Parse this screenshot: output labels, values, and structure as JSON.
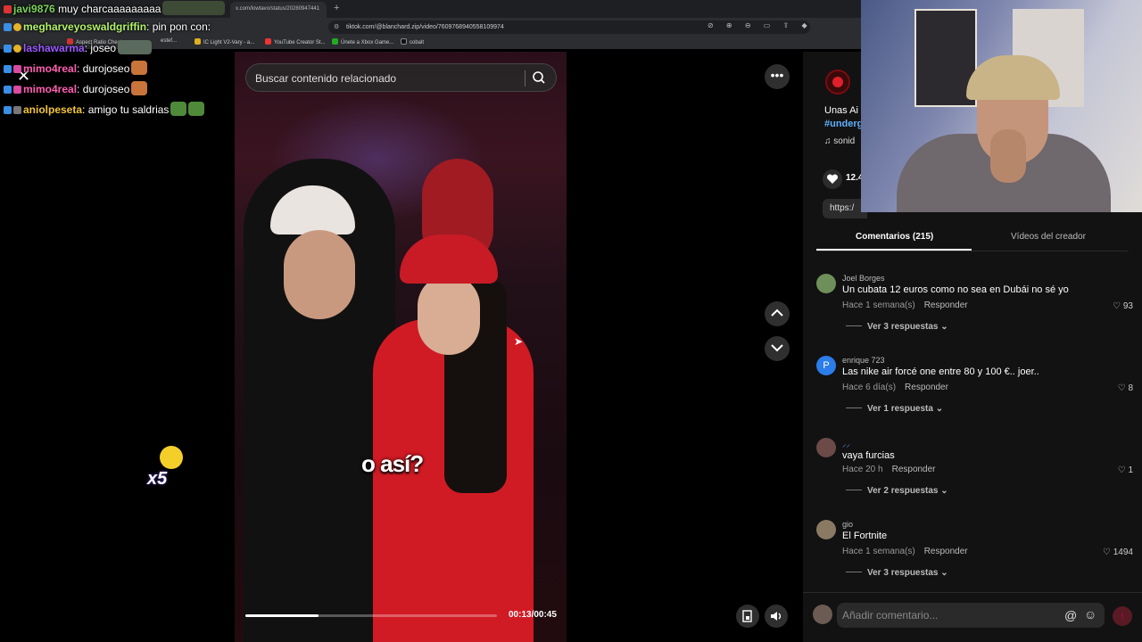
{
  "browser": {
    "tab_title": "x.com/lowtavo/status/20280947441",
    "url": "tiktok.com/@blanchard.zip/video/7609768940558109974",
    "bookmarks": [
      "Aspect Ratio Cheat",
      "estef...",
      "IC Light V2-Vary - a...",
      "YouTube Creator St...",
      "Únete a Xbox Game...",
      "cobalt"
    ]
  },
  "chat": [
    {
      "user": "javi9876",
      "text": "muy charcaaaaaaaaa",
      "color": "#7cd25a"
    },
    {
      "user": "megharveyoswaldgriffin",
      "text": "pin pon con:",
      "color": "#b2f26a"
    },
    {
      "user": "lashawarma",
      "text": "joseo",
      "color": "#9b59ff"
    },
    {
      "user": "mimo4real",
      "text": "durojoseo",
      "color": "#ff5fb2"
    },
    {
      "user": "mimo4real",
      "text": "durojoseo",
      "color": "#ff5fb2"
    },
    {
      "user": "aniolpeseta",
      "text": "amigo tu saldrias",
      "color": "#f2c53a"
    }
  ],
  "bits": {
    "multiplier": "x5"
  },
  "video": {
    "search_placeholder": "Buscar contenido relacionado",
    "caption": "o así?",
    "time": "00:13/00:45",
    "progress": 0.29
  },
  "post": {
    "title": "Unas Ai",
    "hashtag": "#underg",
    "sound": "♫  sonid",
    "likes": "12.4",
    "link": "https:/"
  },
  "tabs": {
    "comments": "Comentarios (215)",
    "creator_videos": "Vídeos del creador"
  },
  "comments": [
    {
      "name": "Joel Borges",
      "text": "Un cubata 12 euros como no sea en Dubái no sé yo",
      "time": "Hace 1 semana(s)",
      "reply": "Responder",
      "likes": "93",
      "replies": "Ver 3 respuestas",
      "avatar": "#6f8f5a"
    },
    {
      "name": "enrique 723",
      "text": "Las nike air forcé one entre 80 y 100 €.. joer..",
      "time": "Hace 6 día(s)",
      "reply": "Responder",
      "likes": "8",
      "replies": "Ver 1 respuesta",
      "avatar": "#2b7de9",
      "initial": "P"
    },
    {
      "name": "",
      "text": "vaya furcias",
      "time": "Hace 20 h",
      "reply": "Responder",
      "likes": "1",
      "replies": "Ver 2 respuestas",
      "avatar": "#6b4a48"
    },
    {
      "name": "gio",
      "text": "El Fortnite",
      "time": "Hace 1 semana(s)",
      "reply": "Responder",
      "likes": "1494",
      "replies": "Ver 3 respuestas",
      "avatar": "#8a7a64"
    }
  ],
  "comment_bar": {
    "placeholder": "Añadir comentario..."
  }
}
